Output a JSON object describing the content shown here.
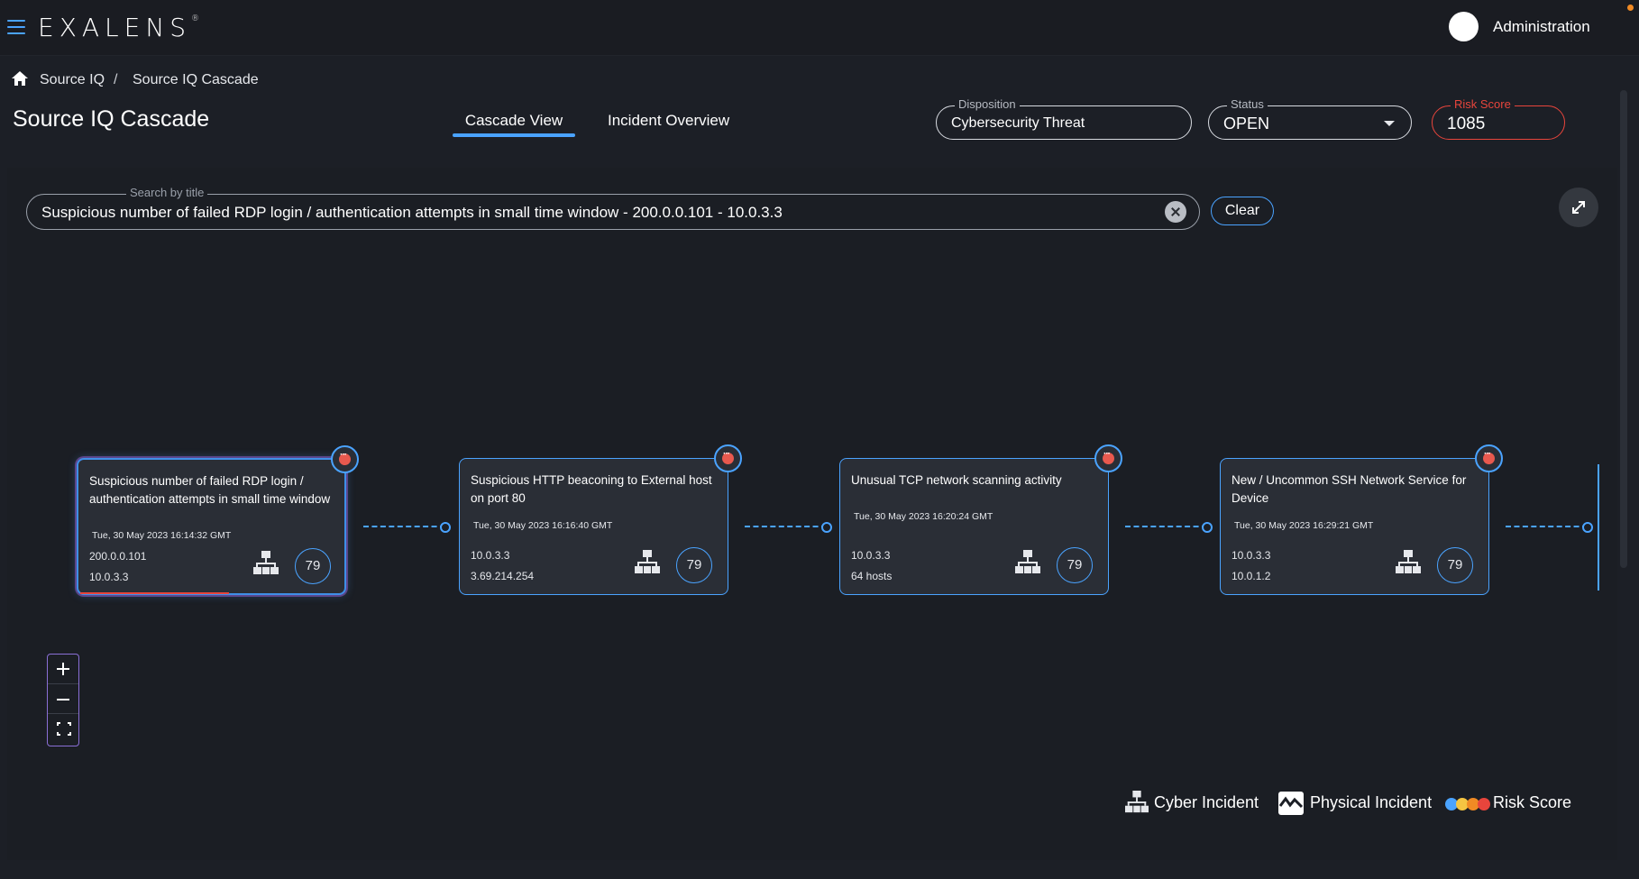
{
  "app": {
    "logo": "EXALENS",
    "trademark": "®",
    "user_label": "Administration"
  },
  "breadcrumb": {
    "items": [
      "Source IQ",
      "Source IQ Cascade"
    ],
    "separator": "/"
  },
  "page": {
    "title": "Source IQ Cascade"
  },
  "tabs": [
    {
      "label": "Cascade View",
      "active": true
    },
    {
      "label": "Incident Overview",
      "active": false
    }
  ],
  "disposition": {
    "label": "Disposition",
    "value": "Cybersecurity Threat"
  },
  "status": {
    "label": "Status",
    "value": "OPEN"
  },
  "risk_score": {
    "label": "Risk Score",
    "value": "1085"
  },
  "search": {
    "label": "Search by title",
    "value": "Suspicious number of failed  RDP login / authentication attempts in small time window - 200.0.0.101 - 10.0.3.3"
  },
  "clear_button": "Clear",
  "cards": [
    {
      "title": "Suspicious number of failed RDP login / authentication attempts in small time window",
      "date": "Tue, 30 May 2023 16:14:32 GMT",
      "source": "200.0.0.101",
      "target": "10.0.3.3",
      "score": "79",
      "selected": true
    },
    {
      "title": "Suspicious HTTP beaconing to External host on port 80",
      "date": "Tue, 30 May 2023 16:16:40 GMT",
      "source": "10.0.3.3",
      "target": "3.69.214.254",
      "score": "79",
      "selected": false
    },
    {
      "title": "Unusual TCP network scanning activity",
      "date": "Tue, 30 May 2023 16:20:24 GMT",
      "source": "10.0.3.3",
      "target": "64 hosts",
      "score": "79",
      "selected": false
    },
    {
      "title": "New / Uncommon SSH Network Service for Device",
      "date": "Tue, 30 May 2023 16:29:21 GMT",
      "source": "10.0.3.3",
      "target": "10.0.1.2",
      "score": "79",
      "selected": false
    }
  ],
  "legend": {
    "cyber": "Cyber Incident",
    "physical": "Physical Incident",
    "risk": "Risk Score",
    "risk_colors": [
      "#4aa3ff",
      "#f5c542",
      "#f08a24",
      "#e8453c"
    ]
  },
  "colors": {
    "accent": "#4aa3ff",
    "danger": "#e8453c",
    "background": "#1c1f26"
  }
}
